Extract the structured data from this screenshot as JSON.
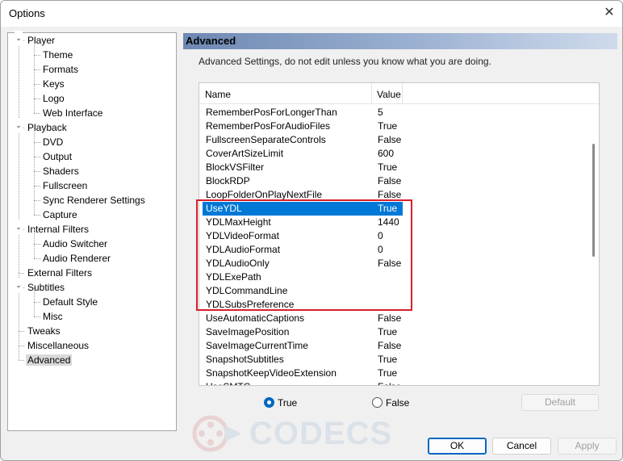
{
  "window": {
    "title": "Options"
  },
  "tree": {
    "items": [
      {
        "label": "Player",
        "level": 0,
        "expanded": true
      },
      {
        "label": "Theme",
        "level": 1
      },
      {
        "label": "Formats",
        "level": 1
      },
      {
        "label": "Keys",
        "level": 1
      },
      {
        "label": "Logo",
        "level": 1
      },
      {
        "label": "Web Interface",
        "level": 1
      },
      {
        "label": "Playback",
        "level": 0,
        "expanded": true
      },
      {
        "label": "DVD",
        "level": 1
      },
      {
        "label": "Output",
        "level": 1
      },
      {
        "label": "Shaders",
        "level": 1
      },
      {
        "label": "Fullscreen",
        "level": 1
      },
      {
        "label": "Sync Renderer Settings",
        "level": 1
      },
      {
        "label": "Capture",
        "level": 1
      },
      {
        "label": "Internal Filters",
        "level": 0,
        "expanded": true
      },
      {
        "label": "Audio Switcher",
        "level": 1
      },
      {
        "label": "Audio Renderer",
        "level": 1
      },
      {
        "label": "External Filters",
        "level": 0
      },
      {
        "label": "Subtitles",
        "level": 0,
        "expanded": true
      },
      {
        "label": "Default Style",
        "level": 1
      },
      {
        "label": "Misc",
        "level": 1
      },
      {
        "label": "Tweaks",
        "level": 0
      },
      {
        "label": "Miscellaneous",
        "level": 0
      },
      {
        "label": "Advanced",
        "level": 0,
        "selected": true
      }
    ]
  },
  "panel": {
    "title": "Advanced",
    "description": "Advanced Settings, do not edit unless you know what you are doing."
  },
  "list": {
    "columns": {
      "name": "Name",
      "value": "Value"
    },
    "selected_index": 7,
    "rows": [
      {
        "name": "RememberPosForLongerThan",
        "value": "5"
      },
      {
        "name": "RememberPosForAudioFiles",
        "value": "True"
      },
      {
        "name": "FullscreenSeparateControls",
        "value": "False"
      },
      {
        "name": "CoverArtSizeLimit",
        "value": "600"
      },
      {
        "name": "BlockVSFilter",
        "value": "True"
      },
      {
        "name": "BlockRDP",
        "value": "False"
      },
      {
        "name": "LoopFolderOnPlayNextFile",
        "value": "False"
      },
      {
        "name": "UseYDL",
        "value": "True"
      },
      {
        "name": "YDLMaxHeight",
        "value": "1440"
      },
      {
        "name": "YDLVideoFormat",
        "value": "0"
      },
      {
        "name": "YDLAudioFormat",
        "value": "0"
      },
      {
        "name": "YDLAudioOnly",
        "value": "False"
      },
      {
        "name": "YDLExePath",
        "value": ""
      },
      {
        "name": "YDLCommandLine",
        "value": ""
      },
      {
        "name": "YDLSubsPreference",
        "value": ""
      },
      {
        "name": "UseAutomaticCaptions",
        "value": "False"
      },
      {
        "name": "SaveImagePosition",
        "value": "True"
      },
      {
        "name": "SaveImageCurrentTime",
        "value": "False"
      },
      {
        "name": "SnapshotSubtitles",
        "value": "True"
      },
      {
        "name": "SnapshotKeepVideoExtension",
        "value": "True"
      },
      {
        "name": "UseSMTC",
        "value": "False"
      }
    ]
  },
  "value_editor": {
    "true_label": "True",
    "false_label": "False",
    "selected": "True",
    "default_label": "Default"
  },
  "buttons": {
    "ok": "OK",
    "cancel": "Cancel",
    "apply": "Apply"
  },
  "watermark": {
    "text": "CODECS"
  },
  "colors": {
    "selection": "#0078d7",
    "highlight_box": "#d6202a",
    "header_band": "#6d88b3"
  }
}
